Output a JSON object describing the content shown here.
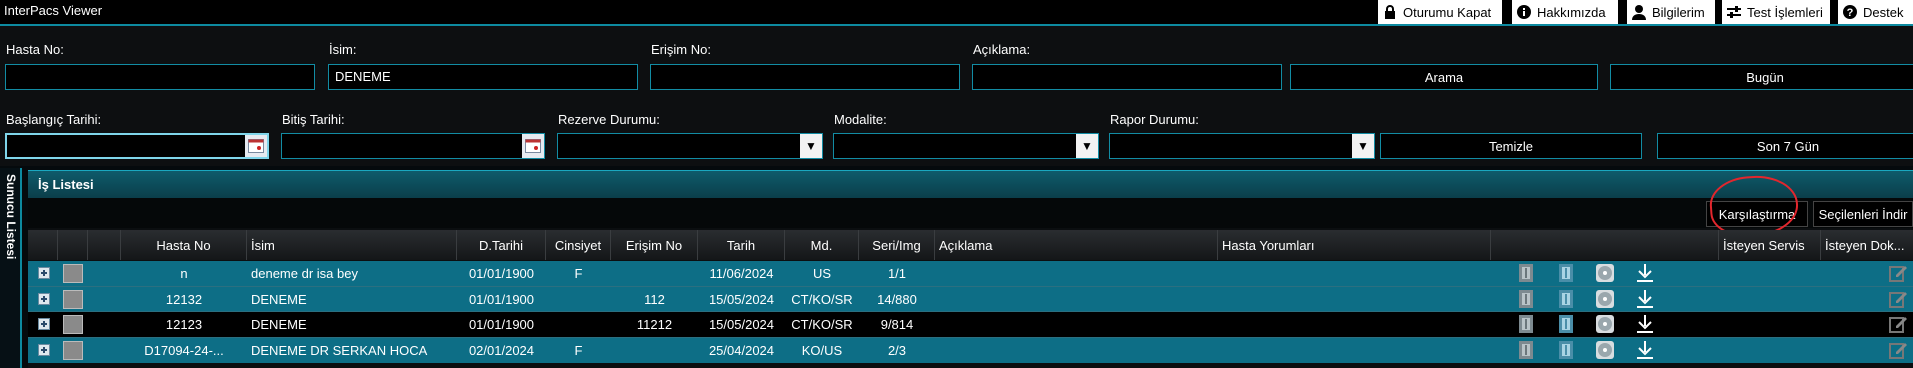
{
  "app": {
    "title": "InterPacs Viewer"
  },
  "topbar": {
    "logout": "Oturumu Kapat",
    "about": "Hakkımızda",
    "my_info": "Bilgilerim",
    "test_ops": "Test İşlemleri",
    "support": "Destek"
  },
  "filters": {
    "patient_no": {
      "label": "Hasta No:",
      "value": ""
    },
    "name": {
      "label": "İsim:",
      "value": "DENEME"
    },
    "access_no": {
      "label": "Erişim No:",
      "value": ""
    },
    "description": {
      "label": "Açıklama:",
      "value": ""
    },
    "search_button": "Arama",
    "today_button": "Bugün",
    "start_date": {
      "label": "Başlangıç Tarihi:",
      "value": ""
    },
    "end_date": {
      "label": "Bitiş Tarihi:",
      "value": ""
    },
    "reserve_status": {
      "label": "Rezerve Durumu:",
      "value": ""
    },
    "modality": {
      "label": "Modalite:",
      "value": ""
    },
    "report_status": {
      "label": "Rapor Durumu:",
      "value": ""
    },
    "clear_button": "Temizle",
    "last7_button": "Son 7 Gün"
  },
  "side_tab": {
    "label": "Sunucu Listesi"
  },
  "worklist": {
    "title": "İş Listesi",
    "compare_button": "Karşılaştırma",
    "download_selected_button": "Seçilenleri İndir",
    "columns": [
      "Hasta No",
      "İsim",
      "D.Tarihi",
      "Cinsiyet",
      "Erişim No",
      "Tarih",
      "Md.",
      "Seri/Img",
      "Açıklama",
      "Hasta Yorumları",
      "İsteyen Servis",
      "İsteyen Dok..."
    ],
    "rows": [
      {
        "patient_no": "n",
        "name": "deneme dr isa bey",
        "birth": "01/01/1900",
        "sex": "F",
        "access": "",
        "date": "11/06/2024",
        "mod": "US",
        "series": "1/1",
        "selected": true
      },
      {
        "patient_no": "12132",
        "name": "DENEME",
        "birth": "01/01/1900",
        "sex": "",
        "access": "112",
        "date": "15/05/2024",
        "mod": "CT/KO/SR",
        "series": "14/880",
        "selected": true
      },
      {
        "patient_no": "12123",
        "name": "DENEME",
        "birth": "01/01/1900",
        "sex": "",
        "access": "11212",
        "date": "15/05/2024",
        "mod": "CT/KO/SR",
        "series": "9/814",
        "selected": false
      },
      {
        "patient_no": "D17094-24-...",
        "name": "DENEME DR SERKAN HOCA",
        "birth": "02/01/2024",
        "sex": "F",
        "access": "",
        "date": "25/04/2024",
        "mod": "KO/US",
        "series": "2/3",
        "selected": true
      }
    ]
  },
  "colors": {
    "accent": "#0d8aa0",
    "row_selected": "#0d6e86",
    "annotation": "#e3262d"
  }
}
